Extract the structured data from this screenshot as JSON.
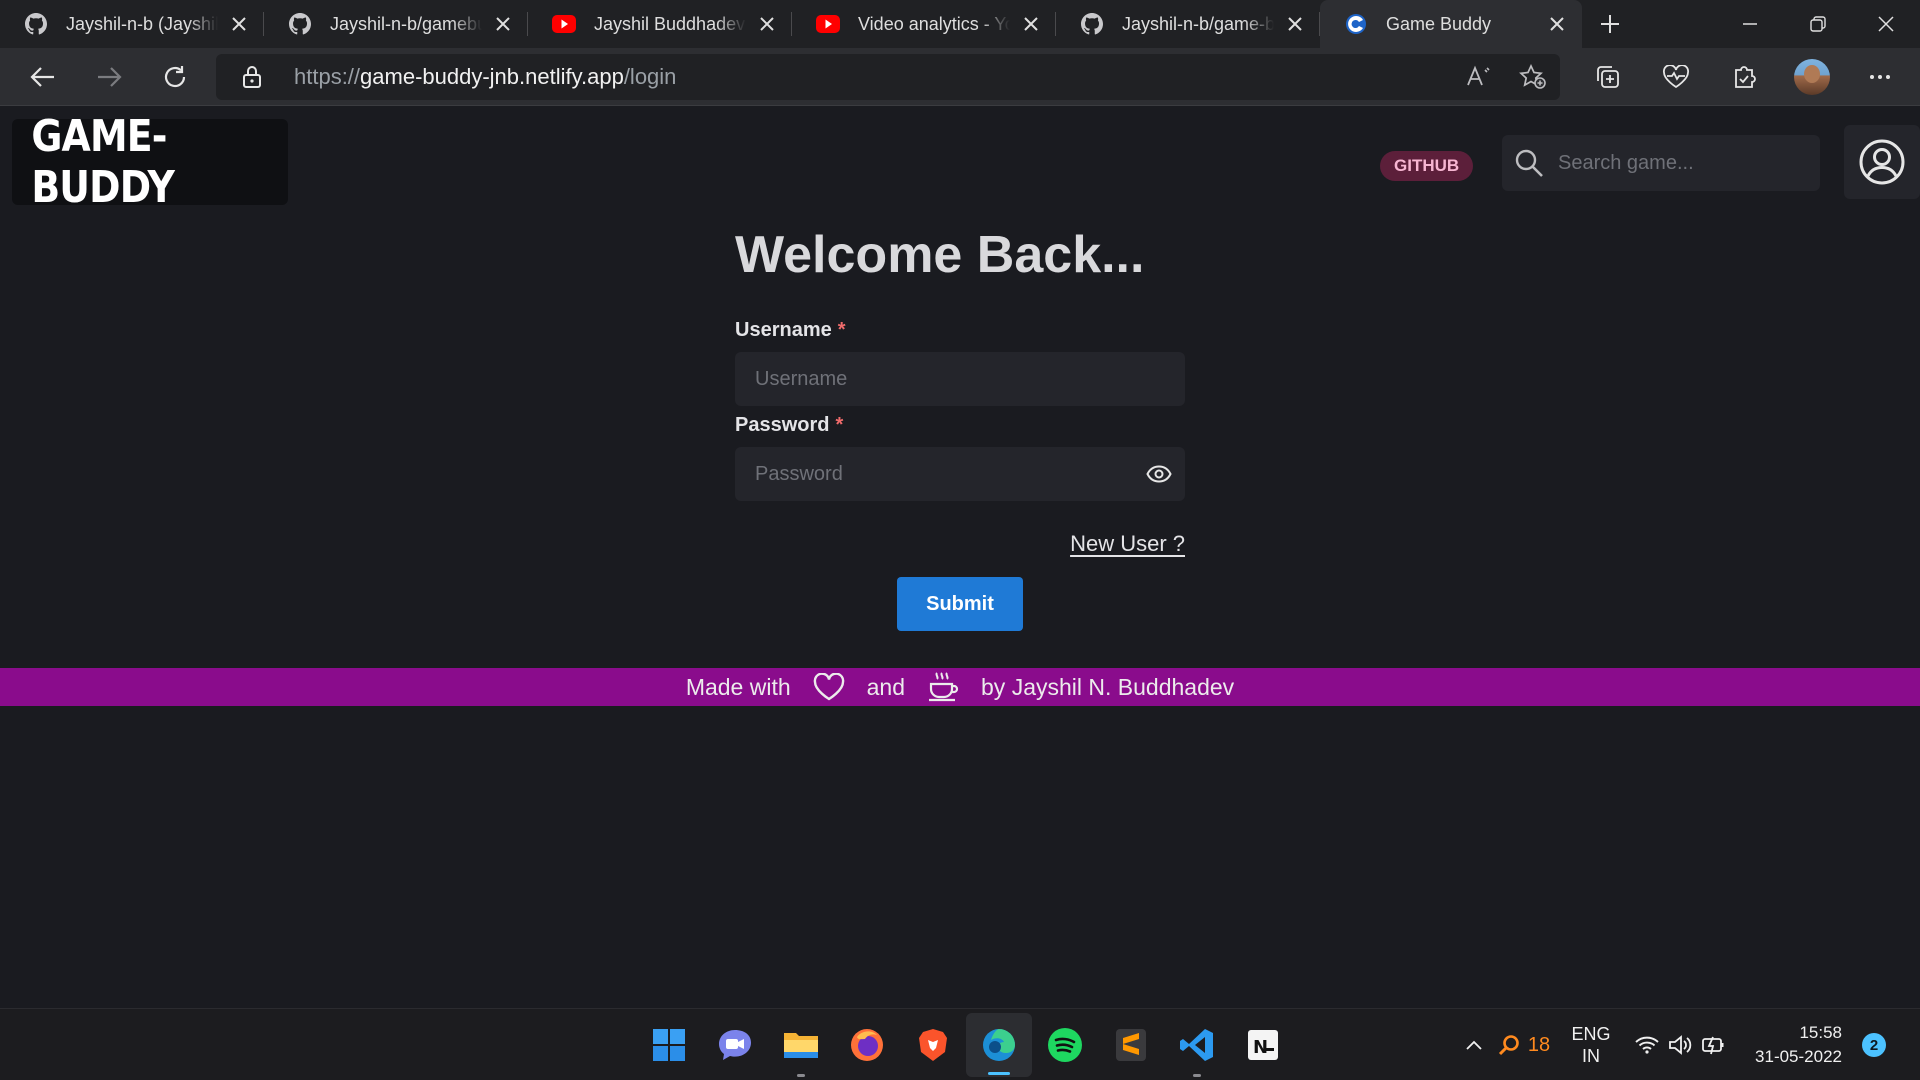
{
  "browser": {
    "tabs": [
      {
        "title": "Jayshil-n-b (Jayshil N. Buddhadev)",
        "favicon": "github-icon"
      },
      {
        "title": "Jayshil-n-b/gamebuddy",
        "favicon": "github-icon"
      },
      {
        "title": "Jayshil Buddhadev - YouTube",
        "favicon": "youtube-icon"
      },
      {
        "title": "Video analytics - YouTube Studio",
        "favicon": "youtube-icon"
      },
      {
        "title": "Jayshil-n-b/game-buddy",
        "favicon": "github-icon"
      },
      {
        "title": "Game Buddy",
        "favicon": "game-buddy-icon",
        "active": true
      }
    ],
    "address": {
      "scheme": "https://",
      "host": "game-buddy-jnb.netlify.app",
      "path": "/login"
    }
  },
  "app": {
    "logo": "GAME-BUDDY",
    "github_badge": "GITHUB",
    "search_placeholder": "Search game...",
    "login": {
      "title": "Welcome Back...",
      "username_label": "Username",
      "username_placeholder": "Username",
      "password_label": "Password",
      "password_placeholder": "Password",
      "required_mark": "*",
      "new_user_link": "New User ?",
      "submit_label": "Submit"
    },
    "footer": {
      "prefix": "Made with",
      "middle": "and",
      "suffix": "by Jayshil N. Buddhadev"
    },
    "colors": {
      "background": "#1a1b20",
      "accent_button": "#1f7ad6",
      "footer_bar": "#8a0c8c",
      "github_badge": "#5c1f3a"
    }
  },
  "taskbar": {
    "apps": [
      "start-icon",
      "teams-chat-icon",
      "file-explorer-icon",
      "firefox-icon",
      "brave-icon",
      "edge-icon",
      "spotify-icon",
      "sublime-text-icon",
      "vscode-icon",
      "notion-icon"
    ],
    "tray": {
      "search_count": "18",
      "language_line1": "ENG",
      "language_line2": "IN",
      "time": "15:58",
      "date": "31-05-2022",
      "notifications": "2"
    }
  }
}
